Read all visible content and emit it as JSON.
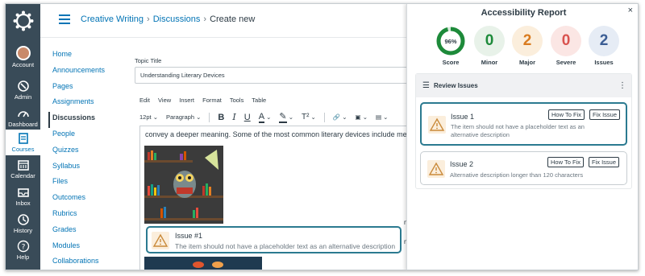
{
  "global_nav": {
    "items": [
      {
        "label": "Account",
        "icon": "avatar"
      },
      {
        "label": "Admin",
        "icon": "shield-icon"
      },
      {
        "label": "Dashboard",
        "icon": "dashboard-icon"
      },
      {
        "label": "Courses",
        "icon": "book-icon"
      },
      {
        "label": "Calendar",
        "icon": "calendar-icon"
      },
      {
        "label": "Inbox",
        "icon": "inbox-icon"
      },
      {
        "label": "History",
        "icon": "clock-icon"
      },
      {
        "label": "Help",
        "icon": "help-icon"
      }
    ],
    "active": "Courses"
  },
  "breadcrumb": {
    "course": "Creative Writing",
    "section": "Discussions",
    "current": "Create new"
  },
  "course_nav": [
    "Home",
    "Announcements",
    "Pages",
    "Assignments",
    "Discussions",
    "People",
    "Quizzes",
    "Syllabus",
    "Files",
    "Outcomes",
    "Rubrics",
    "Grades",
    "Modules",
    "Collaborations"
  ],
  "course_nav_active": "Discussions",
  "editor": {
    "topic_label": "Topic Title",
    "topic_value": "Understanding Literary Devices",
    "menu": [
      "Edit",
      "View",
      "Insert",
      "Format",
      "Tools",
      "Table"
    ],
    "font_size": "12pt",
    "block_format": "Paragraph",
    "body_line": "convey a deeper meaning. Some of the most common literary devices include metaphor",
    "trailing_1": "nie",
    "trailing_2": "nd"
  },
  "inline_issue": {
    "title": "Issue #1",
    "message": "The item should not have a placeholder text as an alternative description"
  },
  "panel": {
    "title": "Accessibility Report",
    "close_glyph": "×",
    "scores": [
      {
        "value": "96%",
        "label": "Score",
        "color": "#1d8a3a"
      },
      {
        "value": "0",
        "label": "Minor",
        "color": "#1d8a3a"
      },
      {
        "value": "2",
        "label": "Major",
        "color": "#d97b1f"
      },
      {
        "value": "0",
        "label": "Severe",
        "color": "#d9534f"
      },
      {
        "value": "2",
        "label": "Issues",
        "color": "#3b5d94"
      }
    ],
    "review_title": "Review Issues",
    "issues": [
      {
        "name": "Issue 1",
        "desc": "The item should not have a placeholder text as an alternative description",
        "how_to_fix": "How To Fix",
        "fix_issue": "Fix Issue"
      },
      {
        "name": "Issue 2",
        "desc": "Alternative description longer than 120 characters",
        "how_to_fix": "How To Fix",
        "fix_issue": "Fix Issue"
      }
    ]
  },
  "colors": {
    "nav_bg": "#394b58",
    "link": "#0374b5",
    "accent": "#2b7a90",
    "warning_bg": "#fbeedc"
  }
}
